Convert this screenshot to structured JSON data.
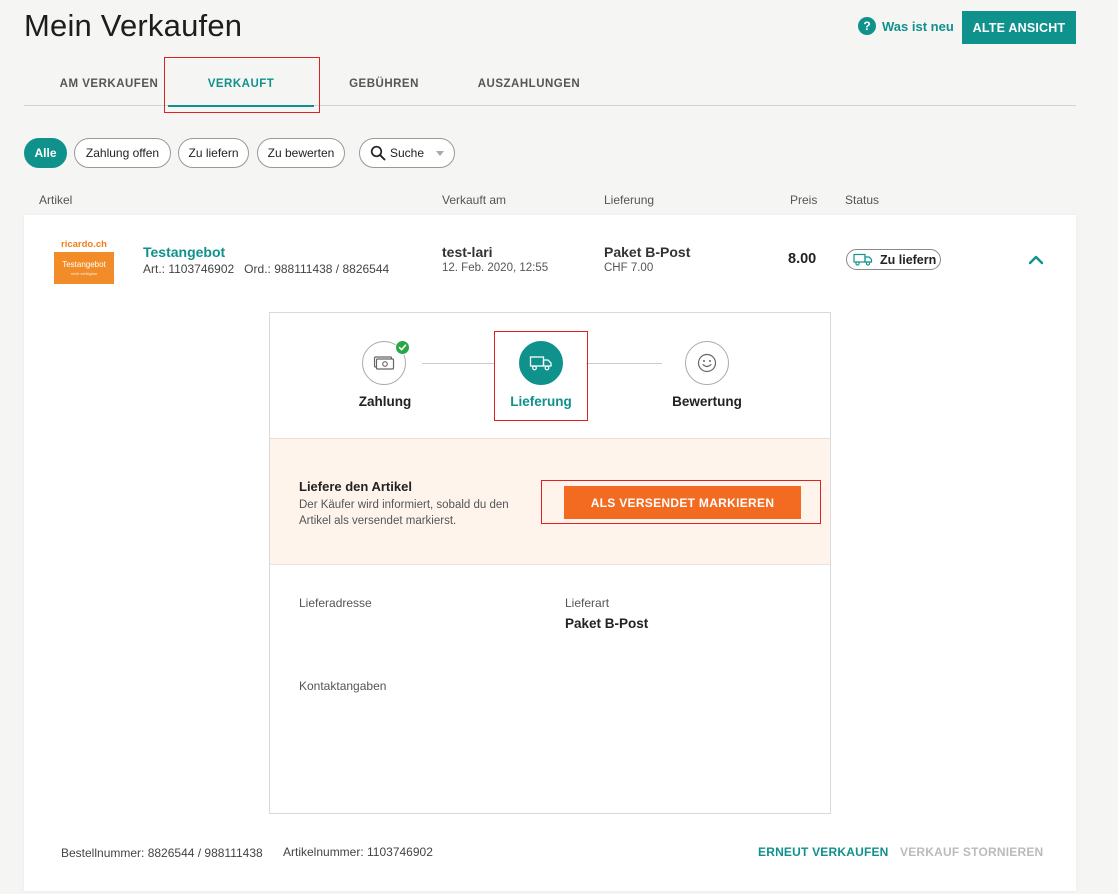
{
  "page": {
    "title": "Mein Verkaufen"
  },
  "header": {
    "whats_new": "Was ist neu",
    "old_view_button": "ALTE ANSICHT"
  },
  "tabs": [
    {
      "label": "AM VERKAUFEN",
      "active": false
    },
    {
      "label": "VERKAUFT",
      "active": true
    },
    {
      "label": "GEBÜHREN",
      "active": false
    },
    {
      "label": "AUSZAHLUNGEN",
      "active": false
    }
  ],
  "filters": {
    "chips": [
      {
        "label": "Alle",
        "active": true
      },
      {
        "label": "Zahlung offen",
        "active": false
      },
      {
        "label": "Zu liefern",
        "active": false
      },
      {
        "label": "Zu bewerten",
        "active": false
      }
    ],
    "search_label": "Suche"
  },
  "columns": {
    "article": "Artikel",
    "sold_on": "Verkauft am",
    "delivery": "Lieferung",
    "price": "Preis",
    "status": "Status"
  },
  "item": {
    "thumb_logo": "ricardo.ch",
    "thumb_text": "Testangebot",
    "thumb_subtext": "nicht verfügbar",
    "title": "Testangebot",
    "ids_line": "Art.: 1103746902   Ord.: 988111438 / 8826544",
    "buyer": "test-lari",
    "sold_date": "12. Feb. 2020, 12:55",
    "shipping_type": "Paket B-Post",
    "shipping_cost": "CHF 7.00",
    "price": "8.00",
    "status": "Zu liefern"
  },
  "steps": [
    {
      "label": "Zahlung",
      "icon": "cash-icon",
      "completed": true
    },
    {
      "label": "Lieferung",
      "icon": "truck-icon",
      "active": true
    },
    {
      "label": "Bewertung",
      "icon": "smiley-icon",
      "completed": false
    }
  ],
  "action_panel": {
    "title": "Liefere den Artikel",
    "text": "Der Käufer wird informiert, sobald du den Artikel als versendet markierst.",
    "button": "ALS VERSENDET MARKIEREN"
  },
  "details": {
    "address_label": "Lieferadresse",
    "delivery_type_label": "Lieferart",
    "delivery_type_value": "Paket B-Post",
    "contact_label": "Kontaktangaben"
  },
  "footer": {
    "order_number": "Bestellnummer: 8826544 / 988111438",
    "article_number": "Artikelnummer: 1103746902",
    "resell": "ERNEUT VERKAUFEN",
    "cancel": "VERKAUF STORNIEREN"
  },
  "colors": {
    "accent": "#0f918c",
    "action": "#f36b21",
    "highlight_box": "#e02020",
    "success": "#28a745"
  }
}
